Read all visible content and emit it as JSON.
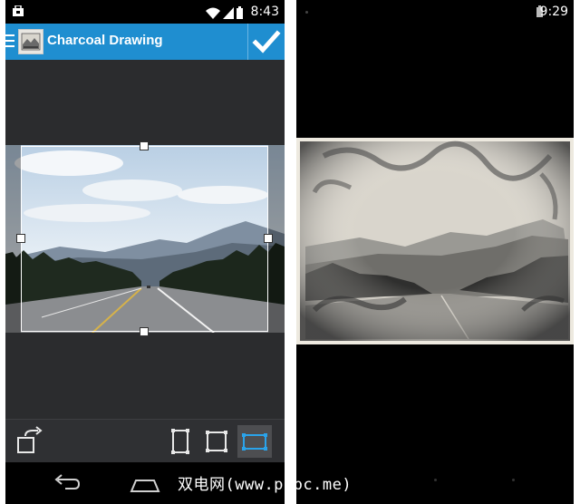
{
  "left_phone": {
    "status_time": "8:43",
    "app_title": "Charcoal Drawing",
    "icons": {
      "notification": "bag-icon",
      "wifi": "wifi-icon",
      "signal": "signal-icon",
      "battery": "battery-icon",
      "menu": "hamburger-icon",
      "confirm": "checkmark-icon",
      "rotate": "rotate-icon",
      "crop_portrait": "crop-portrait-icon",
      "crop_square": "crop-square-icon",
      "crop_landscape": "crop-landscape-icon",
      "back": "back-icon",
      "home": "home-icon"
    },
    "selected_crop_mode": "crop_landscape",
    "accent_color": "#1f8ed0"
  },
  "right_phone": {
    "status_time": "9:29",
    "icons": {
      "battery": "battery-icon"
    }
  },
  "watermark": "双电网(www.pcpc.me)"
}
